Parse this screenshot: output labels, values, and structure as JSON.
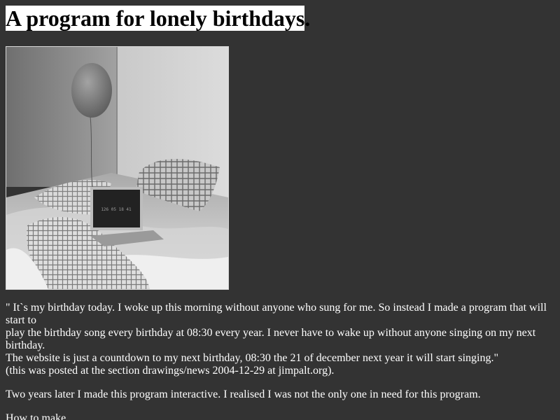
{
  "heading": {
    "title": "A program for lonely birthdays",
    "period": "."
  },
  "photo": {
    "laptop_screen_text": "126 05 18 41"
  },
  "quote": {
    "line1": "\" It`s my birthday today. I woke up this morning without anyone who sung for me. So instead I made a program that will start to",
    "line2": "play the birthday song every birthday at 08:30 every year. I never have to wake up without anyone singing on my next birthday.",
    "line3": "The website is just a countdown to my next birthday, 08:30 the 21 of december next year it will start singing.\"",
    "line4": "(this was posted at the section drawings/news 2004-12-29 at jimpalt.org)."
  },
  "paragraph2": "Two years later I made this program interactive. I realised I was not the only one in need for this program.",
  "paragraph3_cut": "How to make..."
}
